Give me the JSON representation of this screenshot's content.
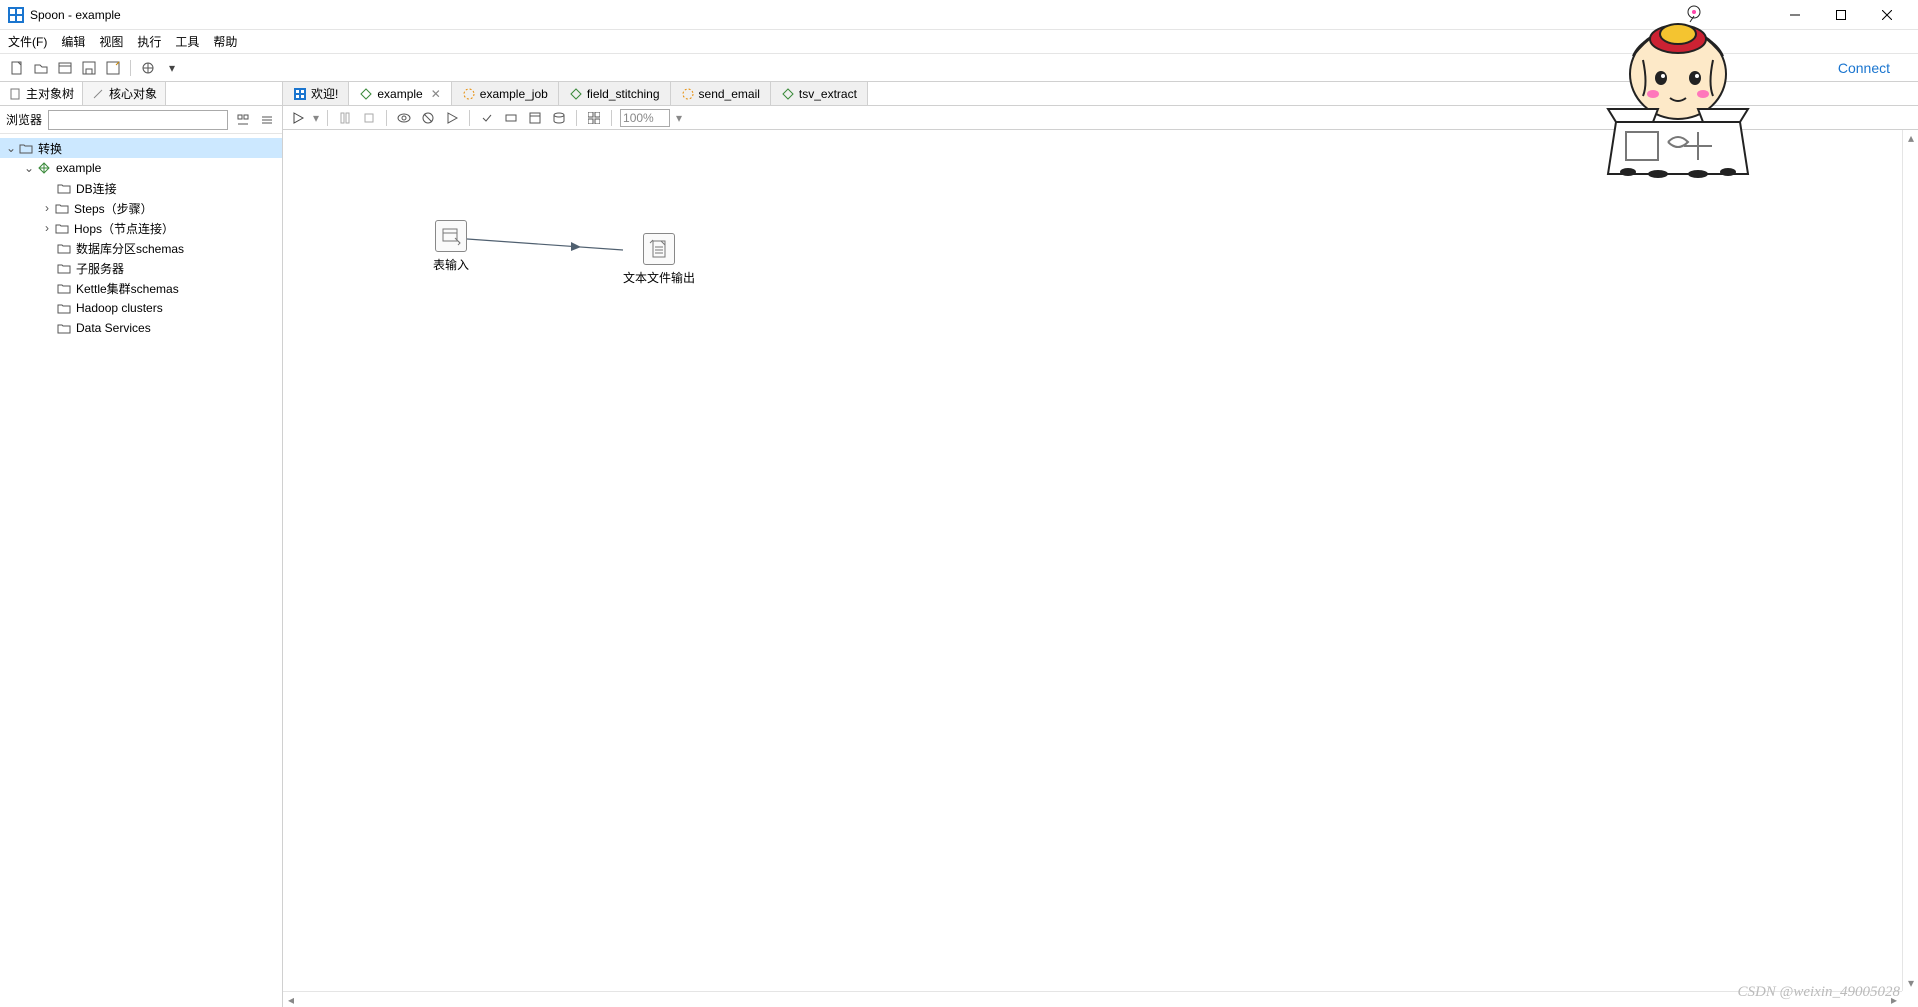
{
  "window": {
    "title": "Spoon - example"
  },
  "menu": {
    "file": "文件(F)",
    "edit": "编辑",
    "view": "视图",
    "run": "执行",
    "tools": "工具",
    "help": "帮助"
  },
  "connect": "Connect",
  "sidebar": {
    "tab_main": "主对象树",
    "tab_core": "核心对象",
    "browser_label": "浏览器",
    "filter_value": ""
  },
  "tree": {
    "root": "转换",
    "example": "example",
    "db": "DB连接",
    "steps": "Steps（步骤）",
    "hops": "Hops（节点连接）",
    "schemas": "数据库分区schemas",
    "subserver": "子服务器",
    "kettle": "Kettle集群schemas",
    "hadoop": "Hadoop clusters",
    "dataservices": "Data Services"
  },
  "tabs": {
    "welcome": "欢迎!",
    "example": "example",
    "example_job": "example_job",
    "field_stitching": "field_stitching",
    "send_email": "send_email",
    "tsv_extract": "tsv_extract"
  },
  "zoom": "100%",
  "steps": {
    "table_input": "表输入",
    "text_output": "文本文件输出"
  },
  "watermark": "CSDN @weixin_49005028"
}
